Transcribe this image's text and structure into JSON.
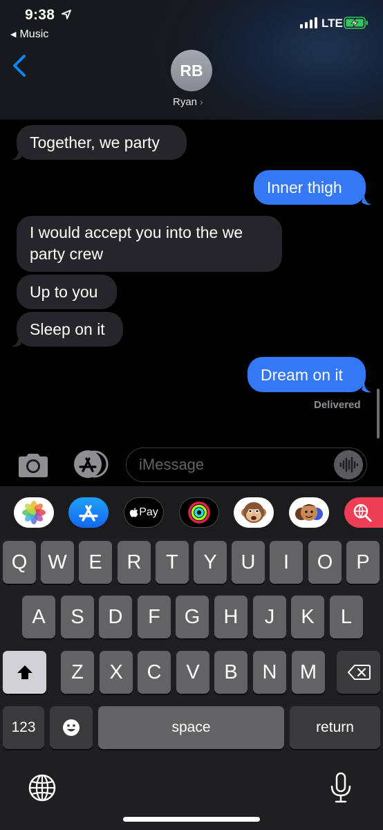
{
  "status": {
    "time": "9:38",
    "back_app": "Music",
    "carrier": "LTE"
  },
  "header": {
    "avatar_initials": "RB",
    "contact_name": "Ryan"
  },
  "messages": [
    {
      "text": "Together, we party",
      "direction": "incoming"
    },
    {
      "text": "Inner thigh",
      "direction": "outgoing"
    },
    {
      "text": "I would accept you into the we party crew",
      "direction": "incoming"
    },
    {
      "text": "Up to you",
      "direction": "incoming"
    },
    {
      "text": "Sleep on it",
      "direction": "incoming"
    },
    {
      "text": "Dream on it",
      "direction": "outgoing"
    }
  ],
  "delivery_status": "Delivered",
  "input": {
    "placeholder": "iMessage"
  },
  "apps": {
    "apple_pay": "Pay",
    "icons": [
      "photos-icon",
      "app-store-icon",
      "apple-pay-icon",
      "activity-icon",
      "memoji-monkey-icon",
      "memoji-stickers-icon",
      "web-search-icon"
    ]
  },
  "keyboard": {
    "row1": [
      "Q",
      "W",
      "E",
      "R",
      "T",
      "Y",
      "U",
      "I",
      "O",
      "P"
    ],
    "row2": [
      "A",
      "S",
      "D",
      "F",
      "G",
      "H",
      "J",
      "K",
      "L"
    ],
    "row3": [
      "Z",
      "X",
      "C",
      "V",
      "B",
      "N",
      "M"
    ],
    "numbers": "123",
    "space": "space",
    "return": "return"
  },
  "colors": {
    "outgoing_bubble": "#3478f6",
    "incoming_bubble": "#26252a",
    "accent": "#0a84ff"
  }
}
